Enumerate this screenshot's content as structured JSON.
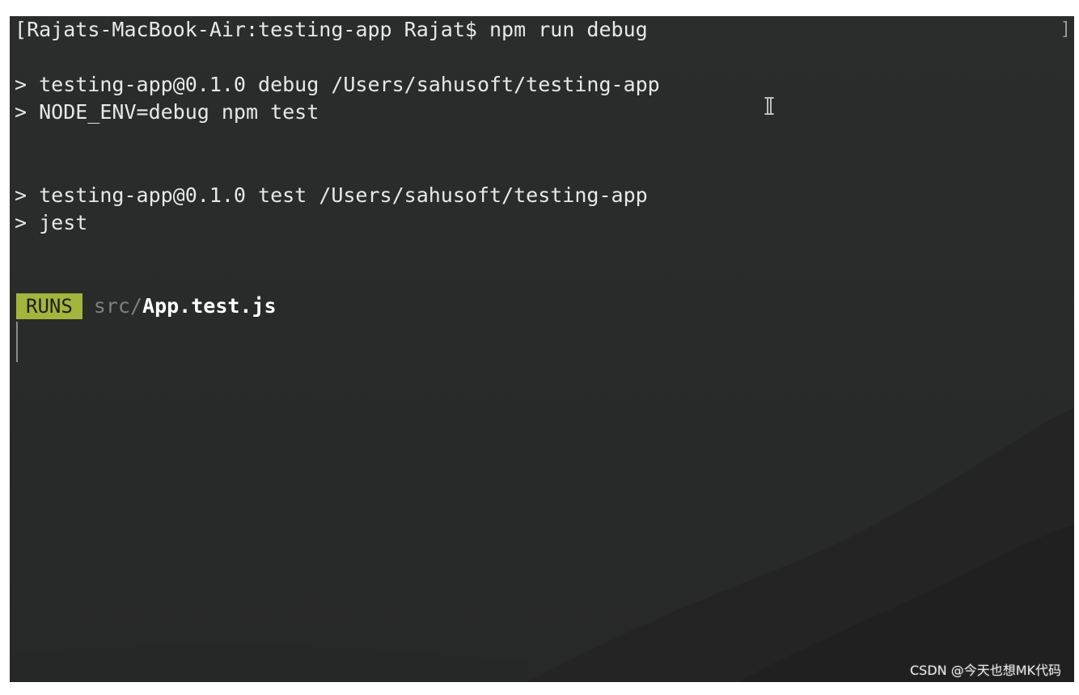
{
  "terminal": {
    "prompt_line": "Rajats-MacBook-Air:testing-app Rajat$ npm run debug",
    "left_bracket": "[",
    "right_bracket": "]",
    "output": [
      "> testing-app@0.1.0 debug /Users/sahusoft/testing-app",
      "> NODE_ENV=debug npm test",
      "> testing-app@0.1.0 test /Users/sahusoft/testing-app",
      "> jest"
    ],
    "runs": {
      "badge": "RUNS",
      "path_prefix": "src/",
      "file": "App.test.js"
    }
  },
  "watermark": "CSDN @今天也想MK代码",
  "colors": {
    "background": "#2a2c2c",
    "runs_badge": "#a3b53c",
    "text": "#e8e8e8",
    "dim_text": "#7d7f80"
  },
  "icons": {
    "cursor": "text-ibeam-cursor"
  }
}
